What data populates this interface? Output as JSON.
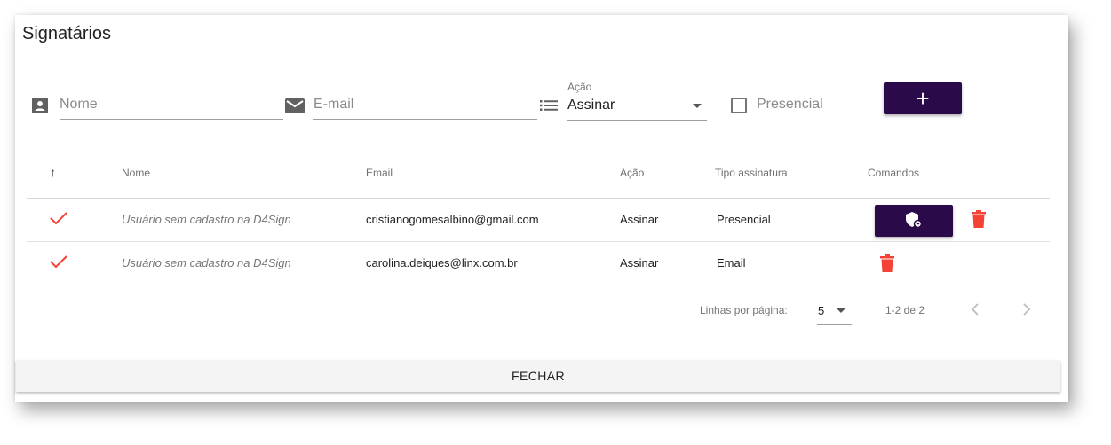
{
  "dialog": {
    "title": "Signatários"
  },
  "form": {
    "name_placeholder": "Nome",
    "email_placeholder": "E-mail",
    "action_label": "Ação",
    "action_value": "Assinar",
    "presencial_label": "Presencial",
    "presencial_checked": false,
    "add_label": "+"
  },
  "table": {
    "headers": {
      "sort": "↑",
      "name": "Nome",
      "email": "Email",
      "action": "Ação",
      "signature_type": "Tipo assinatura",
      "commands": "Comandos"
    },
    "rows": [
      {
        "name": "Usuário sem cadastro na D4Sign",
        "email": "cristianogomesalbino@gmail.com",
        "action": "Assinar",
        "signature_type": "Presencial"
      },
      {
        "name": "Usuário sem cadastro na D4Sign",
        "email": "carolina.deiques@linx.com.br",
        "action": "Assinar",
        "signature_type": "Email"
      }
    ]
  },
  "pagination": {
    "rows_per_page_label": "Linhas por página:",
    "rows_per_page": "5",
    "range": "1-2 de 2"
  },
  "footer": {
    "close_label": "FECHAR"
  },
  "colors": {
    "primary": "#2b0a4a",
    "check": "#f44336",
    "delete": "#f44336"
  },
  "icons": {
    "name": "contact-icon",
    "email": "mail-icon",
    "action": "list-icon",
    "row_status": "check-icon",
    "command": "shield-icon",
    "delete": "trash-icon"
  }
}
